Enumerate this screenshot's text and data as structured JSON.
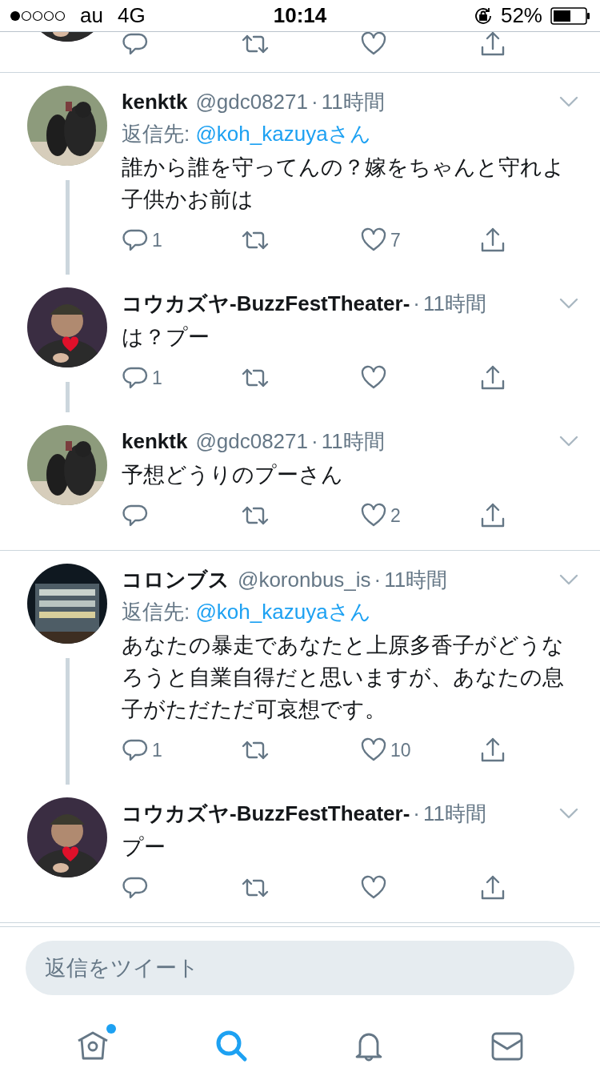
{
  "status_bar": {
    "carrier": "au",
    "network": "4G",
    "time": "10:14",
    "battery": "52%"
  },
  "groups": [
    {
      "tweets": [
        {
          "name": "kenktk",
          "handle": "@gdc08271",
          "dot": "·",
          "time": "11時間",
          "reply_to_label": "返信先:",
          "reply_to": "@koh_kazuyaさん",
          "text": "誰から誰を守ってんの？嫁をちゃんと守れよ子供かお前は",
          "thread_line": true,
          "actions": {
            "reply_count": "1",
            "like_count": "7"
          }
        },
        {
          "name": "コウカズヤ-BuzzFestTheater-",
          "dot": "·",
          "time": "11時間",
          "text": "は？プー",
          "thread_line": true,
          "actions": {
            "reply_count": "1"
          }
        },
        {
          "name": "kenktk",
          "handle": "@gdc08271",
          "dot": "·",
          "time": "11時間",
          "text": "予想どうりのプーさん",
          "thread_line": false,
          "actions": {
            "like_count": "2"
          }
        }
      ]
    },
    {
      "tweets": [
        {
          "name": "コロンブス",
          "handle": "@koronbus_is",
          "dot": "·",
          "time": "11時間",
          "reply_to_label": "返信先:",
          "reply_to": "@koh_kazuyaさん",
          "text": "あなたの暴走であなたと上原多香子がどうなろうと自業自得だと思いますが、あなたの息子がただただ可哀想です。",
          "thread_line": true,
          "actions": {
            "reply_count": "1",
            "like_count": "10"
          }
        },
        {
          "name": "コウカズヤ-BuzzFestTheater-",
          "dot": "·",
          "time": "11時間",
          "text": "プー",
          "thread_line": false
        }
      ]
    }
  ],
  "reply_field": {
    "placeholder": "返信をツイート"
  },
  "tabs": [
    {
      "kind": "home",
      "selected": false,
      "has_new": true
    },
    {
      "kind": "search",
      "selected": true,
      "has_new": false
    },
    {
      "kind": "notifications",
      "selected": false,
      "has_new": false
    },
    {
      "kind": "messages",
      "selected": false,
      "has_new": false
    }
  ]
}
